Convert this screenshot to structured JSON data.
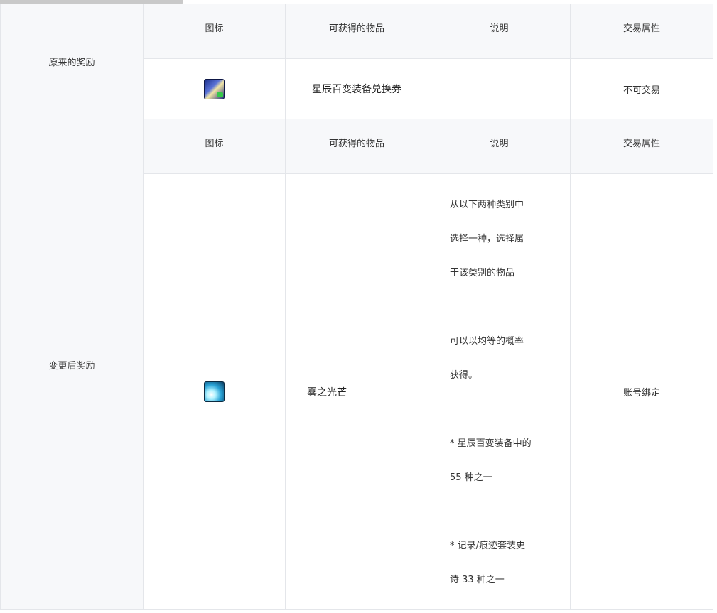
{
  "scrollbar": {
    "visible": true
  },
  "original": {
    "label": "原来的奖励",
    "headers": {
      "icon": "图标",
      "item": "可获得的物品",
      "desc": "说明",
      "trade": "交易属性"
    },
    "row": {
      "icon": "voucher-icon",
      "item": "星辰百变装备兑换券",
      "desc": "",
      "trade": "不可交易"
    }
  },
  "changed": {
    "label": "变更后奖励",
    "headers": {
      "icon": "图标",
      "item": "可获得的物品",
      "desc": "说明",
      "trade": "交易属性"
    },
    "row": {
      "icon": "mist-light-icon",
      "item": "雾之光芒",
      "desc": {
        "l1": "从以下两种类别中",
        "l2": "选择一种，选择属",
        "l3": "于该类别的物品",
        "l4": "可以以均等的概率",
        "l5": "获得。",
        "l6": "* 星辰百变装备中的",
        "l7": "55 种之一",
        "l8": "* 记录/痕迹套装史",
        "l9": "诗 33 种之一"
      },
      "trade": "账号绑定"
    }
  }
}
